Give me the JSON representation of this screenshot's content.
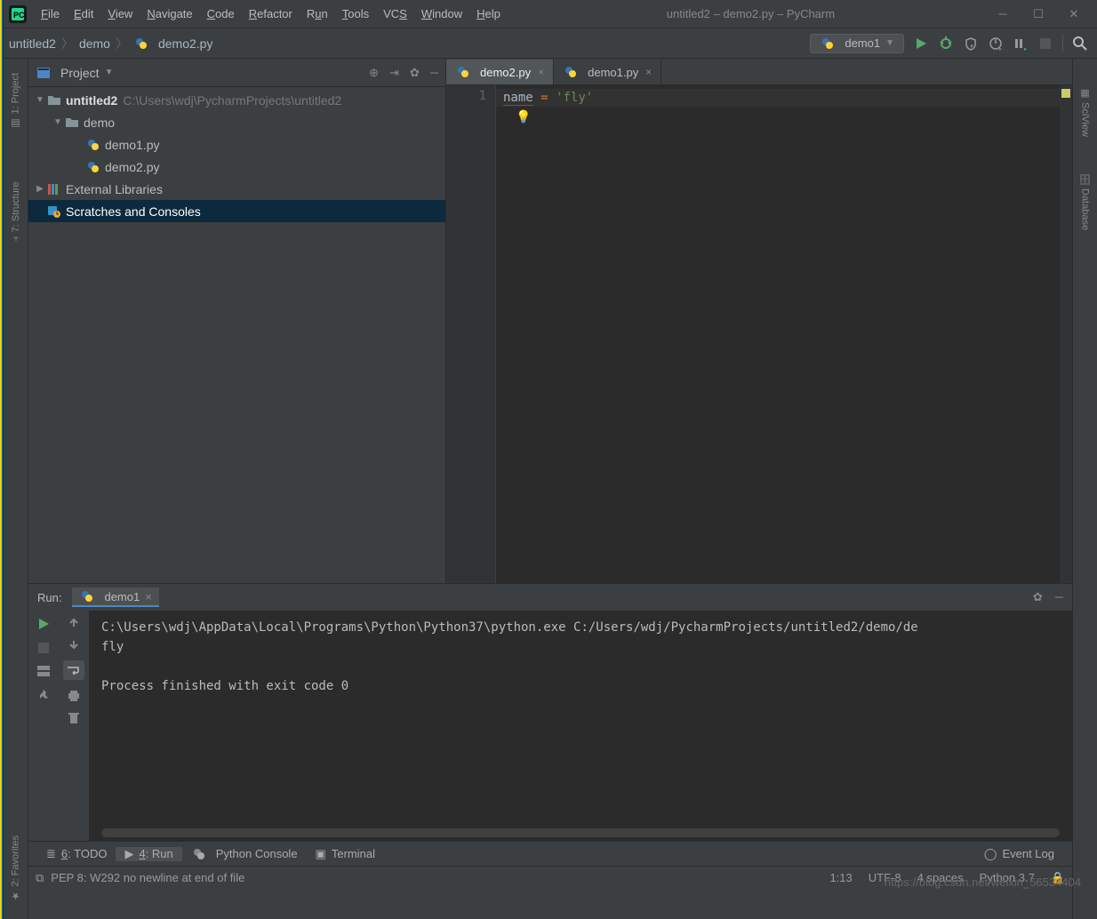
{
  "title": "untitled2 – demo2.py – PyCharm",
  "menu": [
    "File",
    "Edit",
    "View",
    "Navigate",
    "Code",
    "Refactor",
    "Run",
    "Tools",
    "VCS",
    "Window",
    "Help"
  ],
  "breadcrumb": {
    "parts": [
      "untitled2",
      "demo",
      "demo2.py"
    ]
  },
  "runConfig": "demo1",
  "projectPanel": {
    "title": "Project",
    "root": {
      "name": "untitled2",
      "path": "C:\\Users\\wdj\\PycharmProjects\\untitled2"
    },
    "folder": "demo",
    "files": [
      "demo1.py",
      "demo2.py"
    ],
    "extlib": "External Libraries",
    "scratch": "Scratches and Consoles"
  },
  "tabs": [
    {
      "name": "demo2.py",
      "active": true
    },
    {
      "name": "demo1.py",
      "active": false
    }
  ],
  "editor": {
    "lineNo": "1",
    "var": "name",
    "op": "=",
    "str": "'fly'"
  },
  "run": {
    "label": "Run:",
    "tab": "demo1",
    "line1": "C:\\Users\\wdj\\AppData\\Local\\Programs\\Python\\Python37\\python.exe C:/Users/wdj/PycharmProjects/untitled2/demo/de",
    "out": "fly",
    "exit": "Process finished with exit code 0"
  },
  "bottomTools": {
    "todo": "6: TODO",
    "run": "4: Run",
    "pyconsole": "Python Console",
    "terminal": "Terminal",
    "eventlog": "Event Log"
  },
  "leftTabs": {
    "project": "1: Project",
    "structure": "7: Structure",
    "favorites": "2: Favorites"
  },
  "rightTabs": {
    "sciview": "SciView",
    "database": "Database"
  },
  "status": {
    "msg": "PEP 8: W292 no newline at end of file",
    "pos": "1:13",
    "enc": "UTF-8",
    "indent": "4 spaces",
    "python": "Python 3.7"
  },
  "watermark": "https://blog.csdn.net/weixin_56534404"
}
